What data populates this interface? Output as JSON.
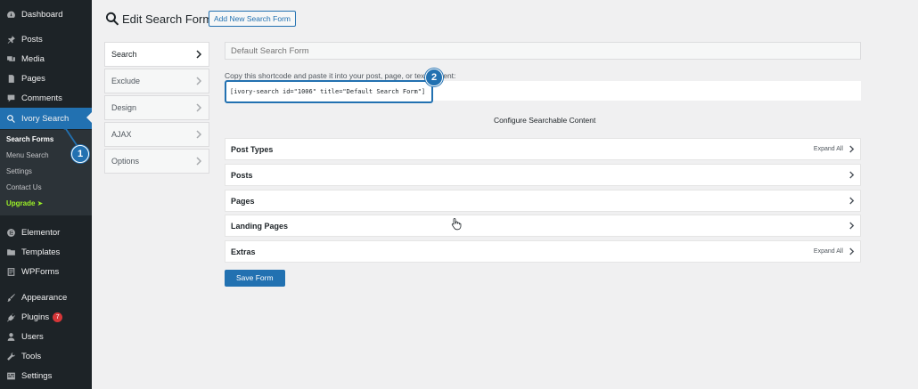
{
  "sidebar": {
    "menu": [
      {
        "label": "Dashboard",
        "icon": "dashboard-icon"
      },
      {
        "label": "Posts",
        "icon": "pin-icon"
      },
      {
        "label": "Media",
        "icon": "media-icon"
      },
      {
        "label": "Pages",
        "icon": "pages-icon"
      },
      {
        "label": "Comments",
        "icon": "comment-icon"
      },
      {
        "label": "Ivory Search",
        "icon": "search-icon"
      },
      {
        "label": "Elementor",
        "icon": "elementor-icon"
      },
      {
        "label": "Templates",
        "icon": "folder-icon"
      },
      {
        "label": "WPForms",
        "icon": "form-icon"
      },
      {
        "label": "Appearance",
        "icon": "brush-icon"
      },
      {
        "label": "Plugins",
        "icon": "plugin-icon",
        "badge": "7"
      },
      {
        "label": "Users",
        "icon": "user-icon"
      },
      {
        "label": "Tools",
        "icon": "wrench-icon"
      },
      {
        "label": "Settings",
        "icon": "settings-icon"
      }
    ],
    "submenu": [
      {
        "label": "Search Forms"
      },
      {
        "label": "Menu Search"
      },
      {
        "label": "Settings"
      },
      {
        "label": "Contact Us"
      },
      {
        "label": "Upgrade ➤"
      }
    ]
  },
  "header": {
    "title": "Edit Search Form",
    "add_new_label": "Add New Search Form"
  },
  "tabs": [
    {
      "label": "Search",
      "active": true
    },
    {
      "label": "Exclude"
    },
    {
      "label": "Design"
    },
    {
      "label": "AJAX"
    },
    {
      "label": "Options"
    }
  ],
  "form": {
    "name_placeholder": "Default Search Form",
    "shortcode_label": "Copy this shortcode and paste it into your post, page, or text       content:",
    "shortcode": "[ivory-search id=\"1006\" title=\"Default Search Form\"]",
    "section_title": "Configure Searchable Content",
    "accordions": [
      {
        "label": "Post Types",
        "expand": "Expand All"
      },
      {
        "label": "Posts"
      },
      {
        "label": "Pages"
      },
      {
        "label": "Landing Pages"
      },
      {
        "label": "Extras",
        "expand": "Expand All"
      }
    ],
    "save_label": "Save Form"
  },
  "steps": {
    "one": "1",
    "two": "2"
  },
  "colors": {
    "accent": "#2271b1",
    "sidebar": "#1d2327",
    "submenu": "#2c3338",
    "upgrade": "#9cf028",
    "badge": "#d63638"
  }
}
